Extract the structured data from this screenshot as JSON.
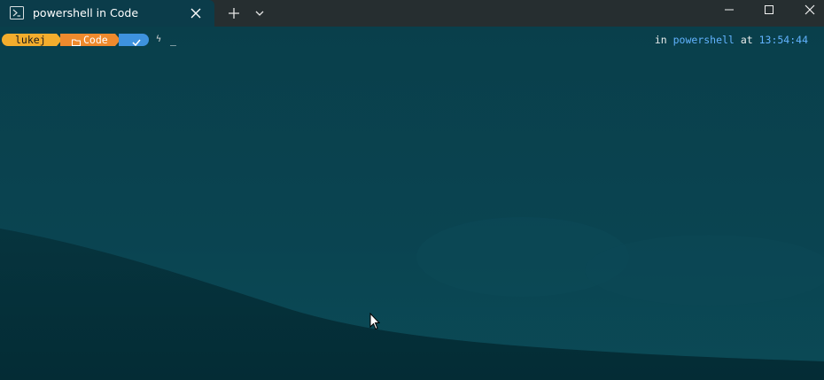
{
  "window": {
    "tab_title": "powershell in Code",
    "tab_icon": "powershell-icon",
    "new_tab_icon": "plus-icon",
    "dropdown_icon": "chevron-down-icon",
    "minimize_icon": "minimize-icon",
    "maximize_icon": "maximize-icon",
    "close_icon": "close-icon"
  },
  "prompt": {
    "user": "lukej",
    "directory": "Code",
    "status_icon": "check-icon",
    "symbol": "ϟ",
    "cursor": "_"
  },
  "right_prompt": {
    "in_label": "in",
    "shell": "powershell",
    "at_label": "at",
    "time": "13:54:44"
  },
  "colors": {
    "titlebar": "#262e30",
    "tab_active": "#0b3c4a",
    "terminal_background": "#083845",
    "user_segment": "#f3ad2d",
    "directory_segment": "#ef8a2d",
    "status_segment": "#3e92de",
    "shell_text": "#62b3ff"
  }
}
